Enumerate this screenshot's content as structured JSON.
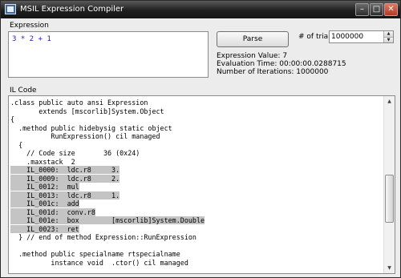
{
  "window": {
    "title": "MSIL Expression Compiler",
    "icons": {
      "app": "app-icon",
      "minimize": "minimize-icon",
      "maximize": "maximize-icon",
      "close": "close-icon"
    }
  },
  "expression": {
    "label": "Expression",
    "value": "3 * 2 + 1"
  },
  "parse_button": {
    "label": "Parse"
  },
  "trials": {
    "label": "# of trials:",
    "value": "1000000"
  },
  "results": {
    "expression_value": "Expression Value: 7",
    "evaluation_time": "Evaluation Time: 00:00:00.0288715",
    "iterations": "Number of Iterations: 1000000"
  },
  "il_code": {
    "label": "IL Code",
    "lines": [
      ".class public auto ansi Expression",
      "       extends [mscorlib]System.Object",
      "{",
      "  .method public hidebysig static object",
      "          RunExpression() cil managed",
      "  {",
      "    // Code size       36 (0x24)",
      "    .maxstack  2",
      "    IL_0000:  ldc.r8     3.",
      "    IL_0009:  ldc.r8     2.",
      "    IL_0012:  mul",
      "    IL_0013:  ldc.r8     1.",
      "    IL_001c:  add",
      "    IL_001d:  conv.r8",
      "    IL_001e:  box        [mscorlib]System.Double",
      "    IL_0023:  ret",
      "  } // end of method Expression::RunExpression",
      "",
      "  .method public specialname rtspecialname",
      "          instance void  .ctor() cil managed"
    ],
    "highlighted_lines": [
      8,
      9,
      10,
      11,
      12,
      13,
      14,
      15
    ]
  },
  "colors": {
    "titlebar": "#1f1f1f",
    "expression_text": "#1f1fa8",
    "highlight": "#c4c4c4"
  }
}
